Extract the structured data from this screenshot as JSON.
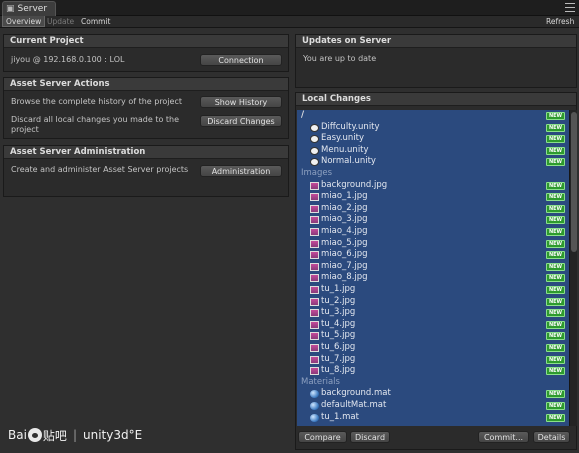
{
  "window": {
    "title": "Server"
  },
  "toolbar": {
    "overview": "Overview",
    "update": "Update",
    "commit": "Commit",
    "refresh": "Refresh"
  },
  "current_project": {
    "header": "Current Project",
    "text": "jiyou @ 192.168.0.100 : LOL",
    "button": "Connection"
  },
  "asset_server_actions": {
    "header": "Asset Server Actions",
    "history_text": "Browse the complete history of the project",
    "history_button": "Show History",
    "discard_text": "Discard all local changes you made to the project",
    "discard_button": "Discard Changes"
  },
  "asset_server_admin": {
    "header": "Asset Server Administration",
    "text": "Create and administer Asset Server projects",
    "button": "Administration"
  },
  "updates": {
    "header": "Updates on Server",
    "text": "You are up to date"
  },
  "local_changes": {
    "header": "Local Changes",
    "badge": "NEW",
    "root": "/",
    "unity_files": [
      "Diffculty.unity",
      "Easy.unity",
      "Menu.unity",
      "Normal.unity"
    ],
    "images_folder": "Images",
    "images": [
      "background.jpg",
      "miao_1.jpg",
      "miao_2.jpg",
      "miao_3.jpg",
      "miao_4.jpg",
      "miao_5.jpg",
      "miao_6.jpg",
      "miao_7.jpg",
      "miao_8.jpg",
      "tu_1.jpg",
      "tu_2.jpg",
      "tu_3.jpg",
      "tu_4.jpg",
      "tu_5.jpg",
      "tu_6.jpg",
      "tu_7.jpg",
      "tu_8.jpg"
    ],
    "materials_folder": "Materials",
    "materials": [
      "background.mat",
      "defaultMat.mat",
      "tu_1.mat"
    ],
    "buttons": {
      "compare": "Compare",
      "discard": "Discard",
      "commit": "Commit...",
      "details": "Details"
    }
  },
  "watermark": {
    "brand_left": "Bai",
    "brand_right": "贴吧",
    "site": "unity3d°E"
  }
}
